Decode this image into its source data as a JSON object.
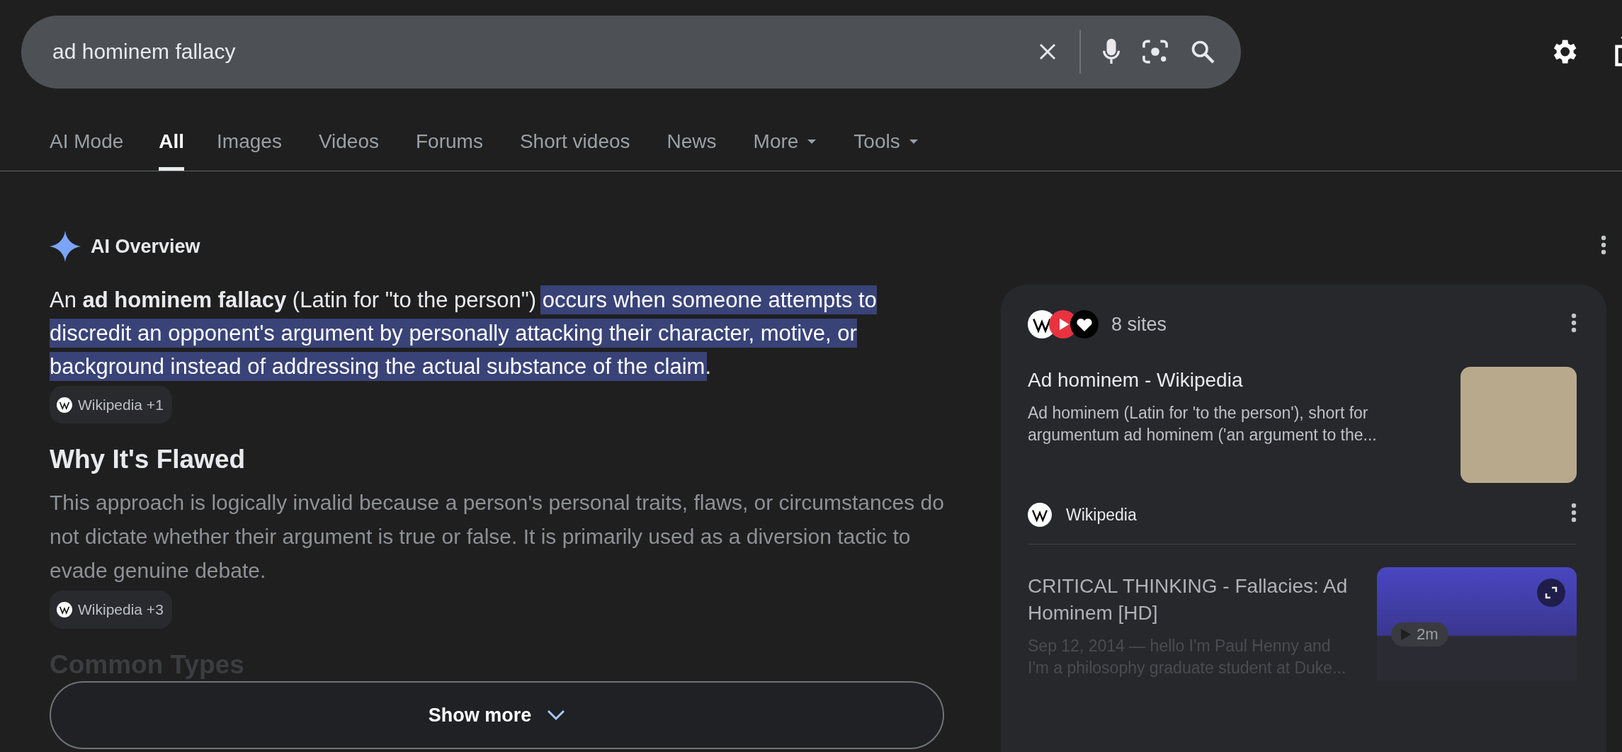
{
  "search": {
    "value": "ad hominem fallacy"
  },
  "tabs": [
    {
      "label": "AI Mode",
      "selected": false,
      "kind": "plain"
    },
    {
      "label": "All",
      "selected": true,
      "kind": "plain"
    },
    {
      "label": "Images",
      "selected": false,
      "kind": "plain"
    },
    {
      "label": "Videos",
      "selected": false,
      "kind": "plain"
    },
    {
      "label": "Forums",
      "selected": false,
      "kind": "plain"
    },
    {
      "label": "Short videos",
      "selected": false,
      "kind": "plain"
    },
    {
      "label": "News",
      "selected": false,
      "kind": "plain"
    },
    {
      "label": "More",
      "selected": false,
      "kind": "menu"
    },
    {
      "label": "Tools",
      "selected": false,
      "kind": "menu"
    }
  ],
  "ai_overview": {
    "title": "AI Overview",
    "intro": [
      {
        "text": "An **ad hominem fallacy** (Latin for \"to the person\")",
        "highlighted": false
      },
      {
        "text": "occurs when someone attempts to discredit an opponent's argument by personally attacking their character, motive, or background instead of addressing the actual substance of the claim",
        "highlighted": true
      },
      {
        "text": ".",
        "highlighted": false
      }
    ],
    "intro_citation": "Wikipedia +1",
    "heading": "Why It's Flawed",
    "paragraph": "This approach is logically invalid because a person's personal traits, flaws, or circumstances do not dictate whether their argument is true or false. It is primarily used as a diversion tactic to evade genuine debate.",
    "paragraph_citation": "Wikipedia +3",
    "next_heading": "Common Types",
    "show_more": "Show more"
  },
  "sources": {
    "count": "8 sites",
    "items": [
      {
        "kind": "article",
        "title": "Ad hominem - Wikipedia",
        "snippet": "Ad hominem (Latin for 'to the person'), short for argumentum ad hominem ('an argument to the...",
        "source": "Wikipedia"
      },
      {
        "kind": "video",
        "title": "CRITICAL THINKING - Fallacies: Ad Hominem [HD]",
        "snippet": "Sep 12, 2014 — hello I'm Paul Henny and I'm a philosophy graduate student at Duke...",
        "duration": "2m"
      }
    ]
  }
}
